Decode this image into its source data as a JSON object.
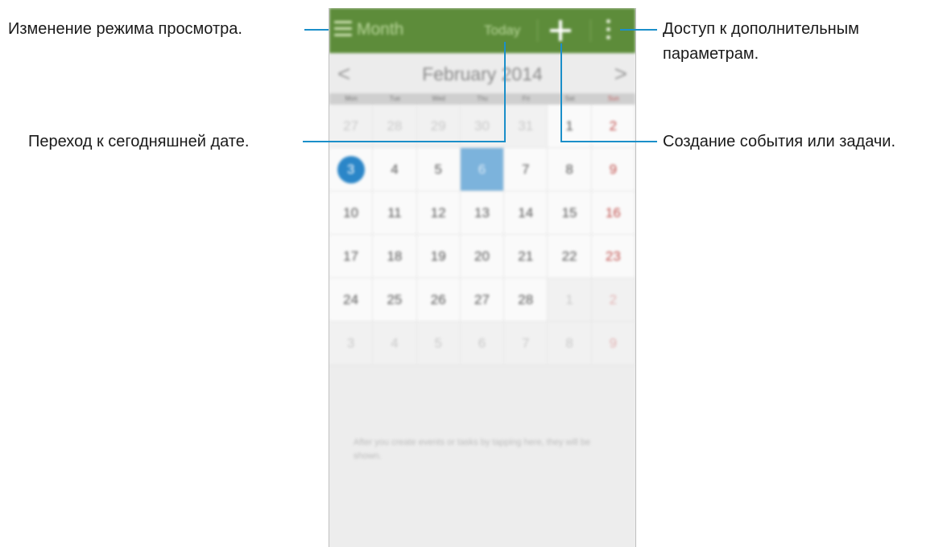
{
  "callouts": {
    "view_mode": "Изменение режима просмотра.",
    "today": "Переход к сегодняшней дате.",
    "more_options_line1": "Доступ к дополнительным",
    "more_options_line2": "параметрам.",
    "create": "Создание события или задачи."
  },
  "colors": {
    "topbar": "#5d8c3a",
    "callout_line": "#1b8fc9",
    "today_circle": "#2b86c8",
    "selected_day": "#7cb3dc",
    "sunday": "#c0504d"
  },
  "toolbar": {
    "menu_icon": "menu-icon",
    "view_label": "Month",
    "today_label": "Today",
    "add_icon": "plus-icon",
    "more_icon": "more-vert-icon"
  },
  "calendar": {
    "prev_label": "<",
    "next_label": ">",
    "month_title": "February 2014",
    "weekdays": [
      "Mon",
      "Tue",
      "Wed",
      "Thu",
      "Fri",
      "Sat",
      "Sun"
    ],
    "weeks": [
      [
        "27",
        "28",
        "29",
        "30",
        "31",
        "1",
        "2"
      ],
      [
        "3",
        "4",
        "5",
        "6",
        "7",
        "8",
        "9"
      ],
      [
        "10",
        "11",
        "12",
        "13",
        "14",
        "15",
        "16"
      ],
      [
        "17",
        "18",
        "19",
        "20",
        "21",
        "22",
        "23"
      ],
      [
        "24",
        "25",
        "26",
        "27",
        "28",
        "1",
        "2"
      ],
      [
        "3",
        "4",
        "5",
        "6",
        "7",
        "8",
        "9"
      ]
    ],
    "empty_message": "After you create events or tasks by tapping here, they will be shown."
  }
}
